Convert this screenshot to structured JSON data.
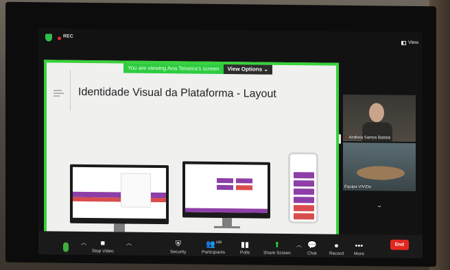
{
  "top_bar": {
    "rec_label": "REC",
    "view_label": "View"
  },
  "share": {
    "banner_text": "You are viewing Ana Teixeira's screen",
    "view_options_label": "View Options",
    "slide_title": "Identidade Visual da Plataforma - Layout"
  },
  "participants": [
    {
      "name": "Andreia Santos Batista"
    },
    {
      "name": "Equipa VIVIDo"
    }
  ],
  "toolbar": {
    "stop_video": "Stop Video",
    "security": "Security",
    "participants": "Participants",
    "participants_count": "128",
    "polls": "Polls",
    "share_screen": "Share Screen",
    "chat": "Chat",
    "record": "Record",
    "more": "More",
    "end": "End"
  },
  "icons": [
    "shield-icon",
    "rec-dot-icon",
    "view-icon",
    "mic-icon",
    "video-icon",
    "security-icon",
    "participants-icon",
    "polls-icon",
    "share-screen-icon",
    "chat-icon",
    "record-icon",
    "more-icon",
    "chevron-down-icon",
    "mic-muted-icon"
  ],
  "colors": {
    "green": "#2ecc40",
    "end_red": "#e2271f",
    "share_border": "#37d23a"
  }
}
